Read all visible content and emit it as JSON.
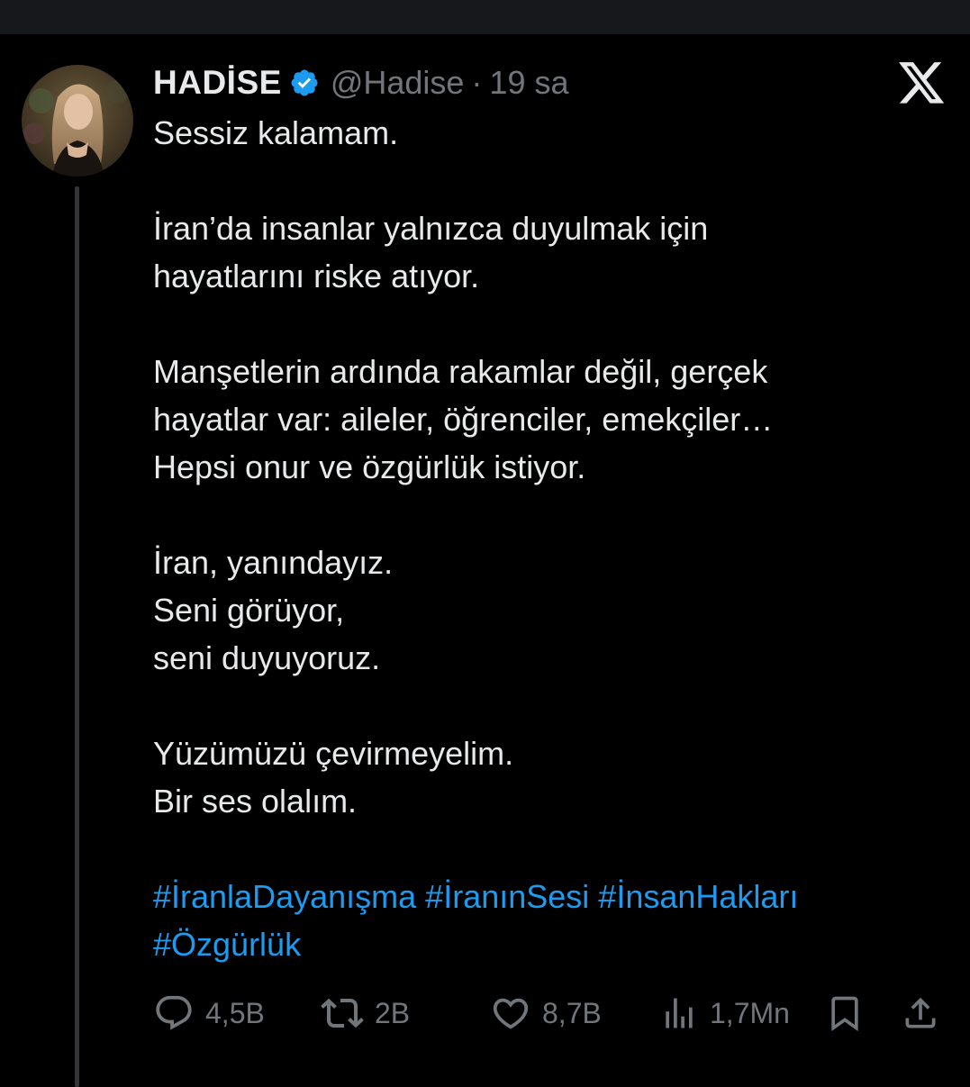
{
  "tweet": {
    "display_name": "HADİSE",
    "handle": "@Hadise",
    "separator": "·",
    "time": "19 sa",
    "verified": true,
    "lines": [
      "Sessiz kalamam.",
      "",
      "İran’da insanlar yalnızca duyulmak için",
      "hayatlarını riske atıyor.",
      "",
      "Manşetlerin ardında rakamlar değil, gerçek",
      "hayatlar var: aileler, öğrenciler, emekçiler…",
      "Hepsi onur ve özgürlük istiyor.",
      "",
      "İran, yanındayız.",
      "Seni görüyor,",
      "seni duyuyoruz.",
      "",
      "Yüzümüzü çevirmeyelim.",
      "Bir ses olalım.",
      ""
    ],
    "hashtags": [
      "#İranlaDayanışma",
      "#İranınSesi",
      "#İnsanHakları",
      "#Özgürlük"
    ]
  },
  "actions": {
    "replies": "4,5B",
    "reposts": "2B",
    "likes": "8,7B",
    "views": "1,7Mn"
  },
  "icons": {
    "verified": "verified-badge-icon",
    "brand": "x-logo-icon",
    "reply": "reply-icon",
    "repost": "repost-icon",
    "like": "heart-icon",
    "views": "views-chart-icon",
    "bookmark": "bookmark-icon",
    "share": "share-icon"
  },
  "colors": {
    "background": "#000000",
    "text": "#e7e9ea",
    "secondary": "#71767b",
    "link": "#1d9bf0",
    "verified": "#1d9bf0"
  }
}
